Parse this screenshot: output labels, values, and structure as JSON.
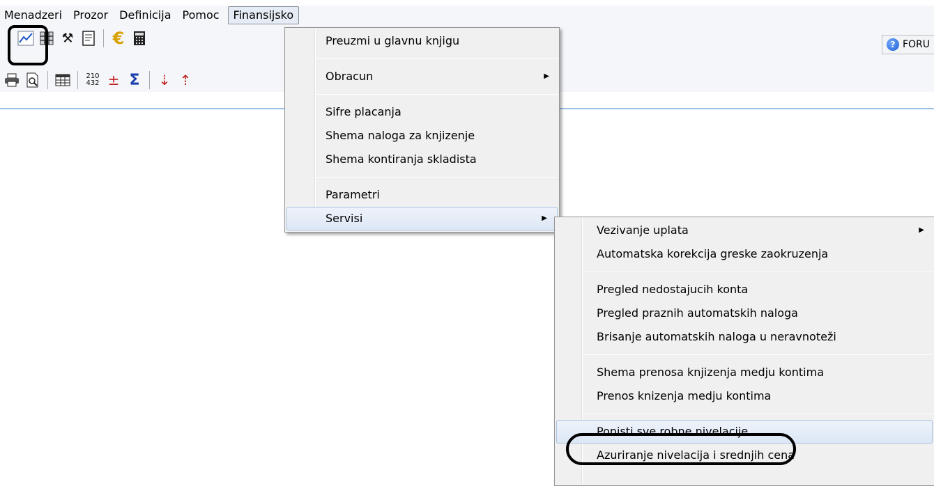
{
  "menubar": {
    "items": [
      {
        "label": "Menadzeri"
      },
      {
        "label": "Prozor"
      },
      {
        "label": "Definicija"
      },
      {
        "label": "Pomoc"
      },
      {
        "label": "Finansijsko"
      }
    ]
  },
  "toolbar_row1": {
    "buttons": [
      {
        "icon": "chart-line-icon",
        "glyph": "⟋"
      },
      {
        "icon": "grid-pattern-icon",
        "glyph": "▦"
      },
      {
        "icon": "tools-icon",
        "glyph": "⚒"
      },
      {
        "icon": "document-icon",
        "glyph": "🗎"
      },
      {
        "icon": "euro-icon",
        "glyph": "€"
      },
      {
        "icon": "calculator-icon",
        "glyph": "▩"
      }
    ],
    "forum_label": "FORU"
  },
  "toolbar_row2": {
    "buttons": [
      {
        "icon": "printer-icon",
        "glyph": "⎙"
      },
      {
        "icon": "print-preview-icon",
        "glyph": "🔍"
      },
      {
        "icon": "table-icon",
        "glyph": "▤"
      },
      {
        "icon": "numbers-icon",
        "glyph": "210/432"
      },
      {
        "icon": "plus-minus-icon",
        "glyph": "±"
      },
      {
        "icon": "sum-icon",
        "glyph": "Σ"
      },
      {
        "icon": "sort-descending-icon",
        "glyph": "⇣"
      },
      {
        "icon": "sort-ascending-icon",
        "glyph": "⇡"
      }
    ]
  },
  "finansijsko_menu": {
    "items": [
      {
        "label": "Preuzmi u glavnu knjigu"
      },
      {
        "label": "Obracun"
      },
      {
        "label": "Sifre placanja"
      },
      {
        "label": "Shema naloga za knjizenje"
      },
      {
        "label": "Shema kontiranja skladista"
      },
      {
        "label": "Parametri"
      },
      {
        "label": "Servisi"
      }
    ]
  },
  "servisi_submenu": {
    "items": [
      {
        "label": "Vezivanje uplata"
      },
      {
        "label": "Automatska korekcija greske zaokruzenja"
      },
      {
        "label": "Pregled nedostajucih konta"
      },
      {
        "label": "Pregled praznih automatskih naloga"
      },
      {
        "label": "Brisanje automatskih naloga u neravnoteži"
      },
      {
        "label": "Shema prenosa knjizenja medju kontima"
      },
      {
        "label": "Prenos knizenja medju kontima"
      },
      {
        "label": "Ponisti sve robne nivelacije"
      },
      {
        "label": "Azuriranje nivelacija i srednjih cena"
      }
    ]
  },
  "colors": {
    "menubar_bg": "#f5f6f9",
    "menu_bg": "#f0f0f0",
    "hover_border": "#a8c2e0",
    "accent_line": "#9cc0e8"
  }
}
